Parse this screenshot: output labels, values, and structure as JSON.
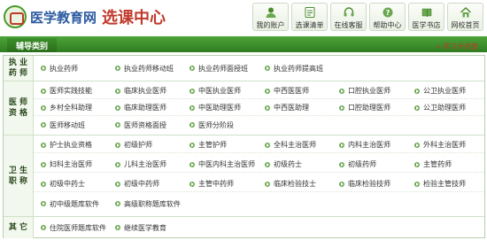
{
  "header": {
    "logo_name": "医学教育网",
    "logo_subtitle": "选课中心"
  },
  "toolbar": [
    {
      "label": "我的账户",
      "icon": "user-icon"
    },
    {
      "label": "选课清单",
      "icon": "list-icon"
    },
    {
      "label": "在线客服",
      "icon": "headset-icon"
    },
    {
      "label": "帮助中心",
      "icon": "help-icon"
    },
    {
      "label": "医学书店",
      "icon": "book-icon"
    },
    {
      "label": "网校首页",
      "icon": "home-icon"
    }
  ],
  "nav": {
    "tab_label": "辅导类别",
    "card_link": "学习卡充值"
  },
  "sections": [
    {
      "title": "执业药师",
      "rows": [
        [
          "执业药师",
          "执业药师移动班",
          "执业药师面授班",
          "执业药师提高班"
        ]
      ]
    },
    {
      "title": "医师资格",
      "rows": [
        [
          "医师实践技能",
          "临床执业医师",
          "中医执业医师",
          "中西医医师",
          "口腔执业医师",
          "公卫执业医师"
        ],
        [
          "乡村全科助理",
          "临床助理医师",
          "中医助理医师",
          "中西医助理",
          "口腔助理医师",
          "公卫助理医师"
        ],
        [
          "医师移动班",
          "医师资格面授",
          "医师分阶段"
        ]
      ]
    },
    {
      "title": "卫生职称",
      "rows": [
        [
          "护士执业资格",
          "初级护师",
          "主管护师",
          "全科主治医师",
          "内科主治医师",
          "外科主治医师"
        ],
        [
          "妇科主治医师",
          "儿科主治医师",
          "中医内科主治医师",
          "初级药士",
          "初级药师",
          "主管药师"
        ],
        [
          "初级中药士",
          "初级中药师",
          "主管中药师",
          "临床检验技士",
          "临床检验技师",
          "检验主管技师"
        ],
        [
          "初中级题库软件",
          "高级职称题库软件"
        ]
      ]
    },
    {
      "title": "其它",
      "rows": [
        [
          "住院医师题库软件",
          "继续医学教育"
        ]
      ]
    }
  ],
  "colors": {
    "brand_green": "#3c8f2a",
    "logo_blue": "#2c5aa0",
    "logo_red": "#c0392b",
    "border_green": "#b7cfae"
  }
}
